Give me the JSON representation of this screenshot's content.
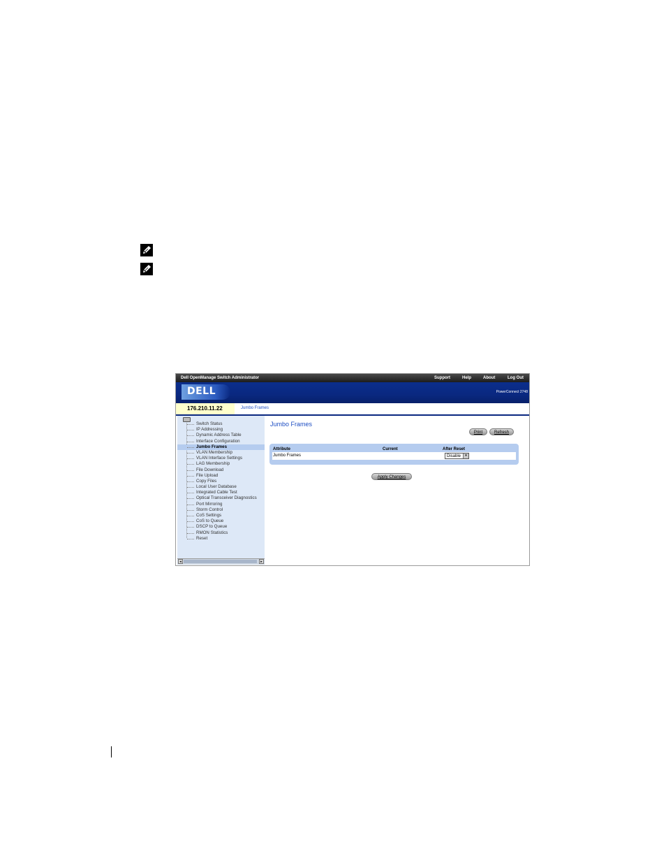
{
  "doc": {
    "note_icon_1": "note-pencil-icon",
    "note_icon_2": "note-pencil-icon"
  },
  "app": {
    "title": "Dell OpenManage Switch Administrator",
    "top_links": [
      "Support",
      "Help",
      "About",
      "Log Out"
    ],
    "logo_text": "DELL",
    "model": "PowerConnect 2748",
    "ip": "176.210.11.22",
    "breadcrumb": "Jumbo Frames"
  },
  "tree": {
    "items": [
      "Switch Status",
      "IP Addressing",
      "Dynamic Address Table",
      "Interface Configuration",
      "Jumbo Frames",
      "VLAN Membership",
      "VLAN Interface Settings",
      "LAG Membership",
      "File Download",
      "File Upload",
      "Copy Files",
      "Local User Database",
      "Integrated Cable Test",
      "Optical Transceiver Diagnostics",
      "Port Mirroring",
      "Storm Control",
      "CoS Settings",
      "CoS to Queue",
      "DSCP to Queue",
      "RMON Statistics",
      "Reset"
    ],
    "selected": "Jumbo Frames"
  },
  "page": {
    "title": "Jumbo Frames",
    "print_label": "Print",
    "refresh_label": "Refresh",
    "table": {
      "headers": [
        "Attribute",
        "Current",
        "After Reset"
      ],
      "row": {
        "attribute": "Jumbo Frames",
        "current": "",
        "after_reset": "Disable"
      }
    },
    "apply_label": "Apply Changes"
  },
  "colors": {
    "banner": "#0a2880",
    "link": "#1f4fc4",
    "panel": "#b5ccef",
    "tree_bg": "#dde8f7",
    "ip_bg": "#ffffcc"
  }
}
